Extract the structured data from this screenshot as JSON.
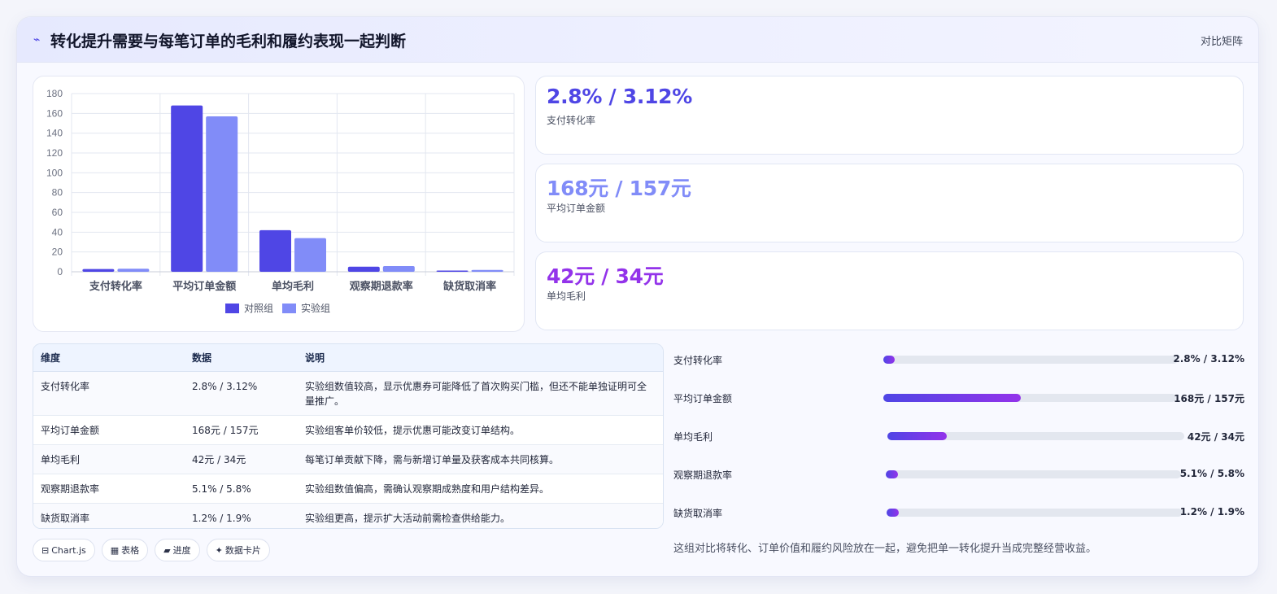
{
  "header": {
    "icon": "trend-line-icon",
    "title": "转化提升需要与每笔订单的毛利和履约表现一起判断",
    "mode_label": "对比矩阵"
  },
  "chart_data": {
    "type": "bar",
    "categories": [
      "支付转化率",
      "平均订单金额",
      "单均毛利",
      "观察期退款率",
      "缺货取消率"
    ],
    "series": [
      {
        "name": "对照组",
        "values": [
          2.8,
          168,
          42,
          5.1,
          1.2
        ],
        "color": "#4f46e5"
      },
      {
        "name": "实验组",
        "values": [
          3.12,
          157,
          34,
          5.8,
          1.9
        ],
        "color": "#818cf8"
      }
    ],
    "ylim": [
      0,
      180
    ],
    "yticks": [
      0,
      20,
      40,
      60,
      80,
      100,
      120,
      140,
      160,
      180
    ],
    "grid": true,
    "legend_position": "bottom"
  },
  "kpis": [
    {
      "value": "2.8% / 3.12%",
      "label": "支付转化率",
      "color": "#4f46e5"
    },
    {
      "value": "168元 / 157元",
      "label": "平均订单金额",
      "color": "#818cf8"
    },
    {
      "value": "42元 / 34元",
      "label": "单均毛利",
      "color": "#9333ea"
    }
  ],
  "table": {
    "headers": [
      "维度",
      "数据",
      "说明"
    ],
    "rows": [
      {
        "dim": "支付转化率",
        "data": "2.8% / 3.12%",
        "note": "实验组数值较高，显示优惠券可能降低了首次购买门槛，但还不能单独证明可全量推广。"
      },
      {
        "dim": "平均订单金额",
        "data": "168元 / 157元",
        "note": "实验组客单价较低，提示优惠可能改变订单结构。"
      },
      {
        "dim": "单均毛利",
        "data": "42元 / 34元",
        "note": "每笔订单贡献下降，需与新增订单量及获客成本共同核算。"
      },
      {
        "dim": "观察期退款率",
        "data": "5.1% / 5.8%",
        "note": "实验组数值偏高，需确认观察期成熟度和用户结构差异。"
      },
      {
        "dim": "缺货取消率",
        "data": "1.2% / 1.9%",
        "note": "实验组更高，提示扩大活动前需检查供给能力。"
      }
    ]
  },
  "tags": [
    {
      "icon": "chart-icon",
      "glyph": "⊟",
      "label": "Chart.js"
    },
    {
      "icon": "table-icon",
      "glyph": "▦",
      "label": "表格"
    },
    {
      "icon": "progress-icon",
      "glyph": "▰",
      "label": "进度"
    },
    {
      "icon": "sparkle-icon",
      "glyph": "✦",
      "label": "数据卡片"
    }
  ],
  "progress": [
    {
      "label": "支付转化率",
      "value": "2.8% / 3.12%",
      "level": 0.04
    },
    {
      "label": "平均订单金额",
      "value": "168元 / 157元",
      "level": 0.47
    },
    {
      "label": "单均毛利",
      "value": "42元 / 34元",
      "level": 0.2
    },
    {
      "label": "观察期退款率",
      "value": "5.1% / 5.8%",
      "level": 0.04
    },
    {
      "label": "缺货取消率",
      "value": "1.2% / 1.9%",
      "level": 0.04
    }
  ],
  "summary": "这组对比将转化、订单价值和履约风险放在一起，避免把单一转化提升当成完整经营收益。"
}
